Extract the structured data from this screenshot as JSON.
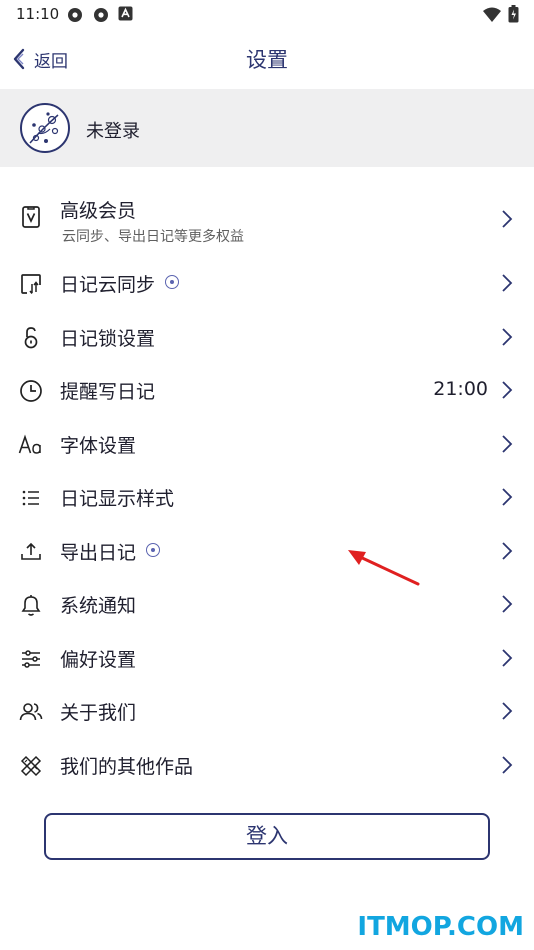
{
  "status_bar": {
    "time": "11:10",
    "left_icons": [
      "settings-gear-icon",
      "settings-gear-icon",
      "notification-a-icon"
    ],
    "right_icons": [
      "wifi-icon",
      "battery-icon"
    ]
  },
  "nav": {
    "back_label": "返回",
    "title": "设置"
  },
  "account": {
    "status": "未登录"
  },
  "menu": [
    {
      "label": "高级会员",
      "sub": "云同步、导出日记等更多权益",
      "icon": "vip-card-icon",
      "value": "",
      "badge": false
    },
    {
      "label": "日记云同步",
      "sub": "",
      "icon": "cloud-sync-icon",
      "value": "",
      "badge": true
    },
    {
      "label": "日记锁设置",
      "sub": "",
      "icon": "lock-icon",
      "value": "",
      "badge": false
    },
    {
      "label": "提醒写日记",
      "sub": "",
      "icon": "clock-icon",
      "value": "21:00",
      "badge": false
    },
    {
      "label": "字体设置",
      "sub": "",
      "icon": "font-icon",
      "value": "",
      "badge": false
    },
    {
      "label": "日记显示样式",
      "sub": "",
      "icon": "list-icon",
      "value": "",
      "badge": false
    },
    {
      "label": "导出日记",
      "sub": "",
      "icon": "export-icon",
      "value": "",
      "badge": true
    },
    {
      "label": "系统通知",
      "sub": "",
      "icon": "bell-icon",
      "value": "",
      "badge": false
    },
    {
      "label": "偏好设置",
      "sub": "",
      "icon": "sliders-icon",
      "value": "",
      "badge": false
    },
    {
      "label": "关于我们",
      "sub": "",
      "icon": "people-icon",
      "value": "",
      "badge": false
    },
    {
      "label": "我们的其他作品",
      "sub": "",
      "icon": "tools-icon",
      "value": "",
      "badge": false
    }
  ],
  "login_button": "登入",
  "watermark": "ITMOP.COM",
  "colors": {
    "accent": "#2c3570",
    "card_bg": "#efeff0",
    "annotation": "#e02020",
    "watermark": "#12a6e0"
  }
}
